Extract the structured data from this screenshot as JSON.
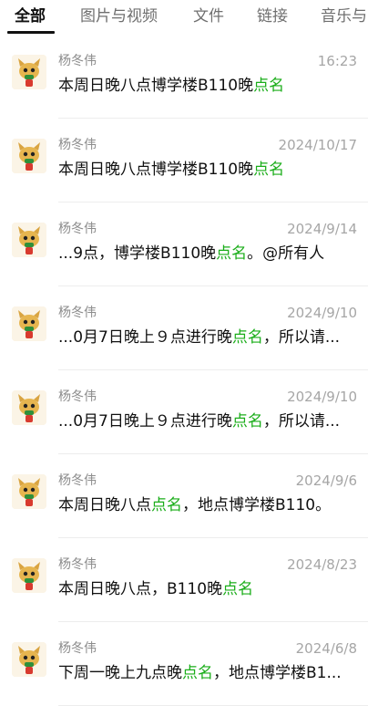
{
  "tabs": [
    {
      "label": "全部",
      "active": true
    },
    {
      "label": "图片与视频",
      "active": false
    },
    {
      "label": "文件",
      "active": false
    },
    {
      "label": "链接",
      "active": false
    },
    {
      "label": "音乐与",
      "active": false
    }
  ],
  "accent_color": "#1aad19",
  "items": [
    {
      "sender": "杨冬伟",
      "date": "16:23",
      "before": "本周日晚八点博学楼B110晚",
      "match": "点名",
      "after": ""
    },
    {
      "sender": "杨冬伟",
      "date": "2024/10/17",
      "before": "本周日晚八点博学楼B110晚",
      "match": "点名",
      "after": ""
    },
    {
      "sender": "杨冬伟",
      "date": "2024/9/14",
      "before": "...9点，博学楼B110晚",
      "match": "点名",
      "after": "。@所有人"
    },
    {
      "sender": "杨冬伟",
      "date": "2024/9/10",
      "before": "...0月7日晚上９点进行晚",
      "match": "点名",
      "after": "，所以请..."
    },
    {
      "sender": "杨冬伟",
      "date": "2024/9/10",
      "before": "...0月7日晚上９点进行晚",
      "match": "点名",
      "after": "，所以请..."
    },
    {
      "sender": "杨冬伟",
      "date": "2024/9/6",
      "before": "本周日晚八点",
      "match": "点名",
      "after": "，地点博学楼B110。"
    },
    {
      "sender": "杨冬伟",
      "date": "2024/8/23",
      "before": "本周日晚八点，B110晚",
      "match": "点名",
      "after": ""
    },
    {
      "sender": "杨冬伟",
      "date": "2024/6/8",
      "before": "下周一晚上九点晚",
      "match": "点名",
      "after": "，地点博学楼B1..."
    }
  ]
}
